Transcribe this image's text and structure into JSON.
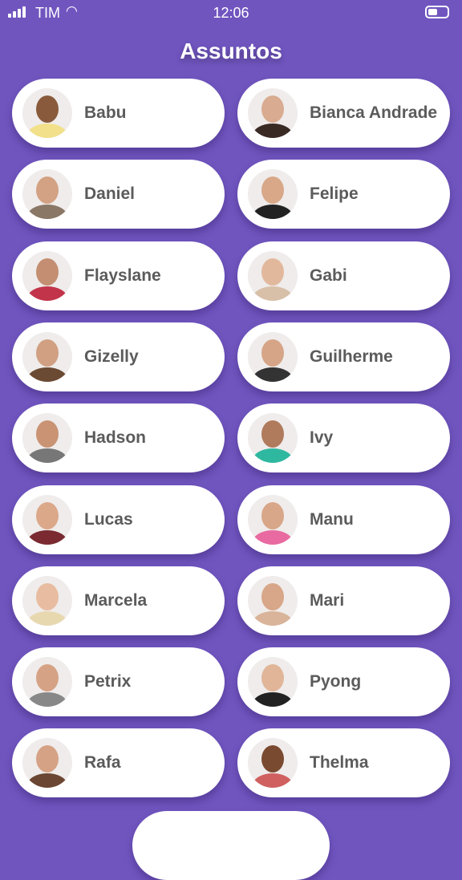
{
  "status": {
    "carrier": "TIM",
    "time": "12:06"
  },
  "header": {
    "title": "Assuntos"
  },
  "subjects": [
    {
      "name": "Babu",
      "shirt": "#f2e08a",
      "skin": "#8a5a3c"
    },
    {
      "name": "Bianca Andrade",
      "shirt": "#3a2a24",
      "skin": "#d9ab90"
    },
    {
      "name": "Daniel",
      "shirt": "#8a7766",
      "skin": "#d3a183"
    },
    {
      "name": "Felipe",
      "shirt": "#222",
      "skin": "#d8a888"
    },
    {
      "name": "Flayslane",
      "shirt": "#c2344a",
      "skin": "#c48e72"
    },
    {
      "name": "Gabi",
      "shirt": "#d8c0a8",
      "skin": "#e2b89c"
    },
    {
      "name": "Gizelly",
      "shirt": "#6b4a34",
      "skin": "#d1a083"
    },
    {
      "name": "Guilherme",
      "shirt": "#333",
      "skin": "#d6a587"
    },
    {
      "name": "Hadson",
      "shirt": "#777",
      "skin": "#c99374"
    },
    {
      "name": "Ivy",
      "shirt": "#2fb8a0",
      "skin": "#b07a5c"
    },
    {
      "name": "Lucas",
      "shirt": "#7a2a30",
      "skin": "#dca88a"
    },
    {
      "name": "Manu",
      "shirt": "#e86aa0",
      "skin": "#d8a688"
    },
    {
      "name": "Marcela",
      "shirt": "#e8d8b0",
      "skin": "#e8bca0"
    },
    {
      "name": "Mari",
      "shirt": "#d9b49a",
      "skin": "#d8a688"
    },
    {
      "name": "Petrix",
      "shirt": "#888",
      "skin": "#d6a285"
    },
    {
      "name": "Pyong",
      "shirt": "#222",
      "skin": "#e0b598"
    },
    {
      "name": "Rafa",
      "shirt": "#6b4632",
      "skin": "#d6a285"
    },
    {
      "name": "Thelma",
      "shirt": "#d06060",
      "skin": "#7a4a30"
    }
  ],
  "colors": {
    "background": "#7055bf",
    "card": "#ffffff",
    "text": "#5b5b5b"
  }
}
